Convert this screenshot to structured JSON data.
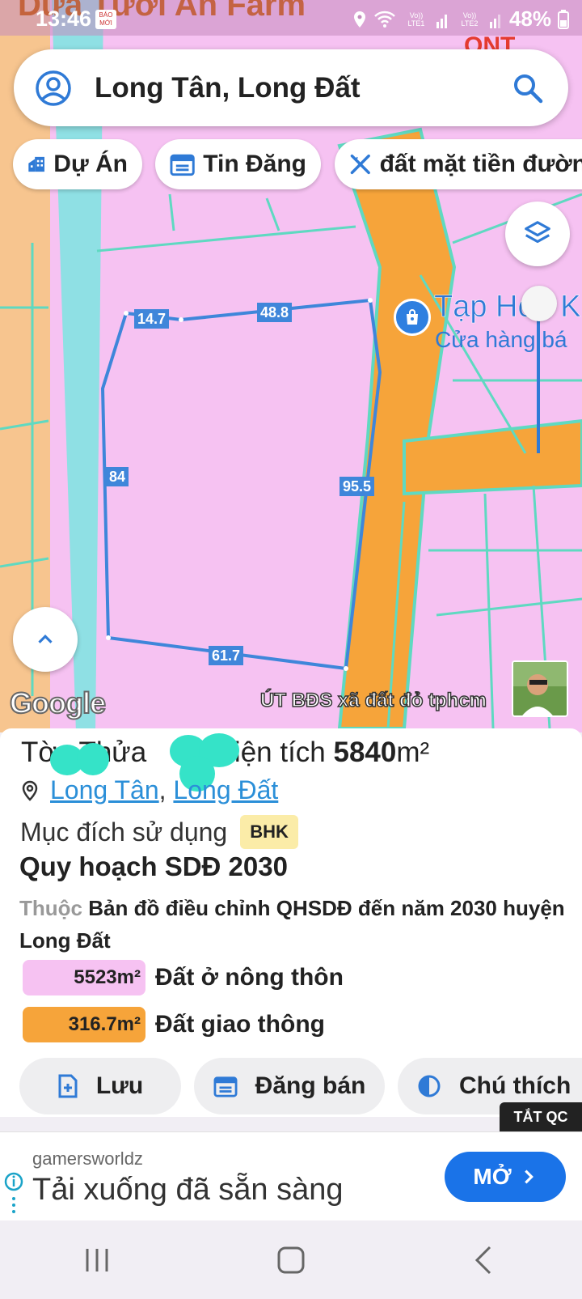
{
  "status_bar": {
    "time": "13:46",
    "badge": "BÁO MỚI",
    "background_text": "Dừa Tươi An Farm",
    "net1": "Vo)) LTE1",
    "net2": "Vo)) LTE2",
    "battery": "48%"
  },
  "map": {
    "ont_label": "ONT",
    "edge_labels": [
      "14.7",
      "48.8",
      "84",
      "95.5",
      "61.7"
    ],
    "poi_name": "Tạp Hóa K",
    "poi_subtitle": "Cửa hàng bá",
    "google_logo": "Google",
    "watermark": "ÚT BĐS xã đất đỏ tphcm",
    "colors": {
      "residential": "#f6c2f2",
      "road": "#f6a43a",
      "road_edge": "#5fd9c1",
      "parcel": "#3f86da"
    }
  },
  "search": {
    "value": "Long Tân, Long Đất"
  },
  "chips": [
    {
      "icon": "building-icon",
      "label": "Dự Án"
    },
    {
      "icon": "calendar-icon",
      "label": "Tin Đăng"
    },
    {
      "icon": "ruler-pencil-icon",
      "label": "đất mặt tiền đườn"
    }
  ],
  "panel": {
    "sheet_prefix": "Tờ",
    "plot_prefix": "Thửa",
    "area_prefix": "Diện tích",
    "area_value": "5840",
    "area_unit": "m²",
    "commune": "Long Tân",
    "district": "Long Đất",
    "purpose_label": "Mục đích sử dụng",
    "purpose_code": "BHK",
    "plan_title": "Quy hoạch SDĐ 2030",
    "plan_belongs": "Thuộc",
    "plan_desc": "Bản đồ điều chỉnh QHSDĐ đến năm 2030 huyện Long Đất",
    "land_uses": [
      {
        "area": "5523m²",
        "label": "Đất ở nông thôn",
        "color": "#f6c2f2"
      },
      {
        "area": "316.7m²",
        "label": "Đất giao thông",
        "color": "#f6a43a"
      }
    ],
    "actions": [
      {
        "icon": "bookmark-add-icon",
        "label": "Lưu"
      },
      {
        "icon": "calendar-icon",
        "label": "Đăng bán"
      },
      {
        "icon": "contrast-icon",
        "label": "Chú thích"
      }
    ]
  },
  "ad": {
    "close_label": "TẮT QC",
    "source": "gamersworldz",
    "message": "Tải xuống đã sẵn sàng",
    "button": "MỞ"
  }
}
